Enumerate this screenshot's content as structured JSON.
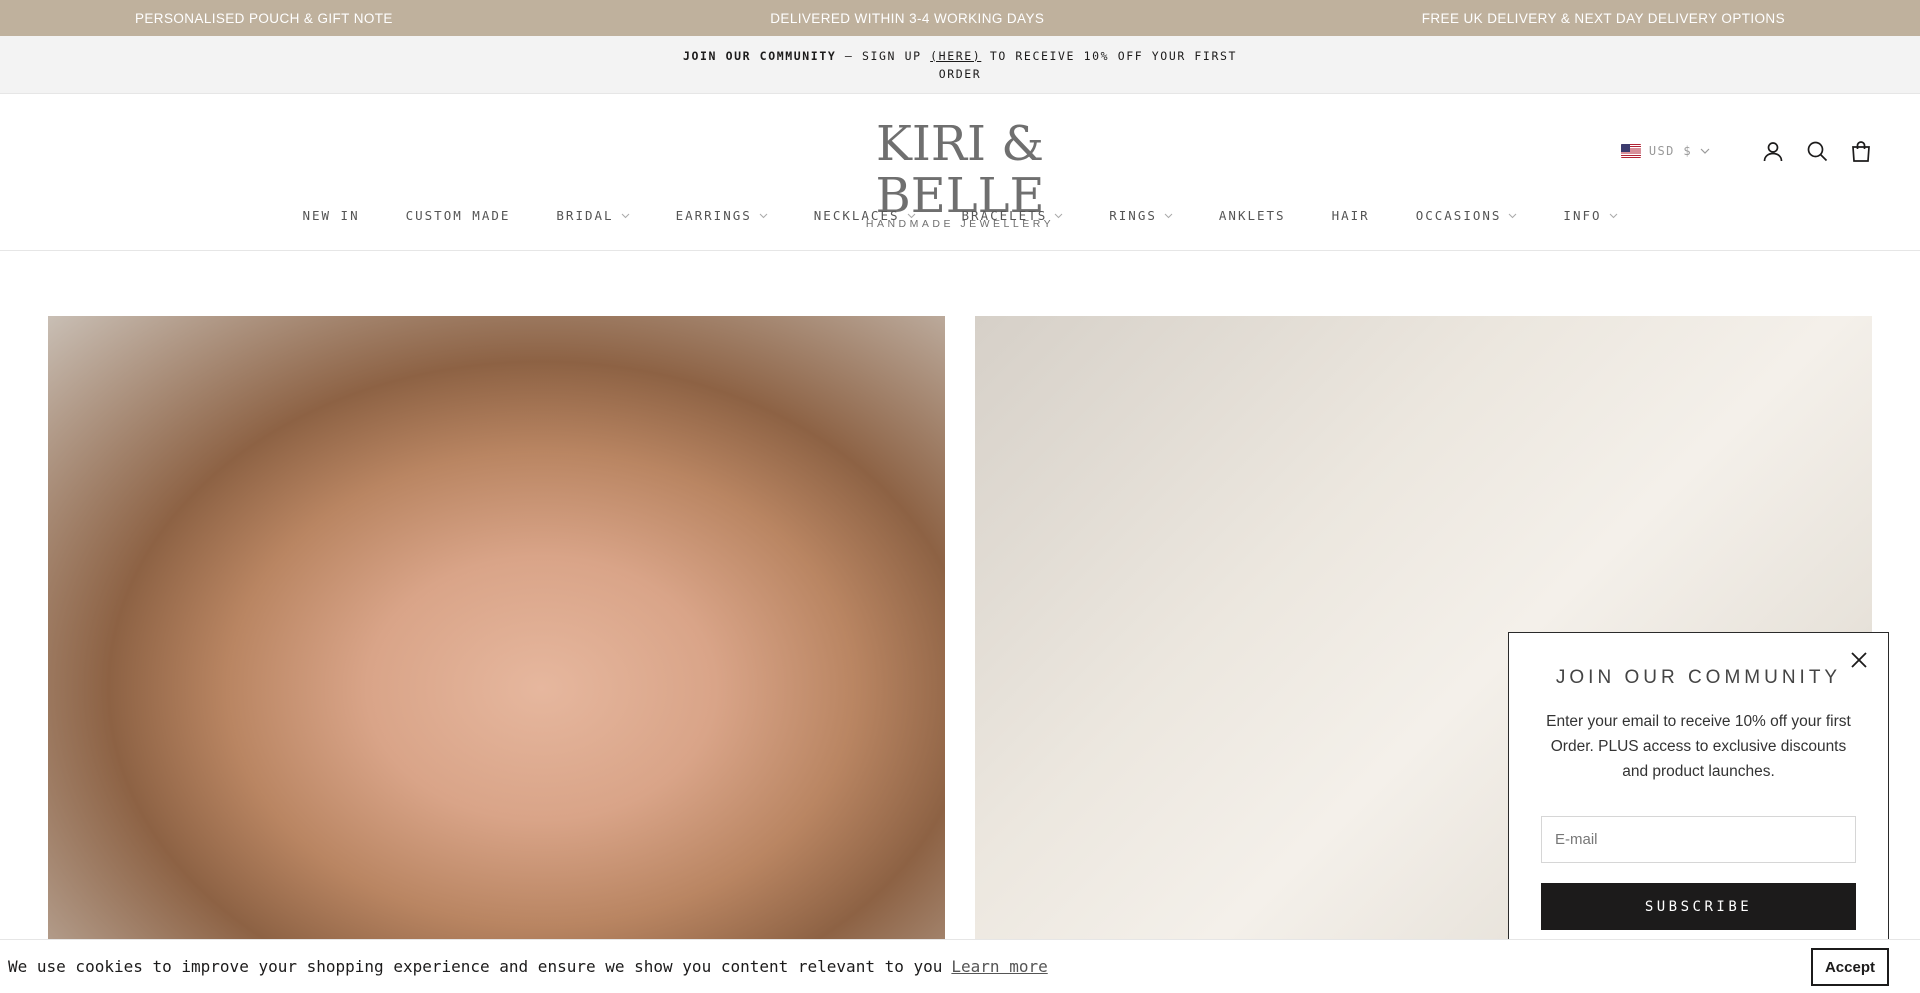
{
  "promo_bar": {
    "items": [
      "PERSONALISED POUCH & GIFT NOTE",
      "DELIVERED WITHIN 3-4 WORKING DAYS",
      "FREE UK DELIVERY & NEXT DAY DELIVERY OPTIONS"
    ],
    "background": "#bfb19d"
  },
  "community_bar": {
    "strong": "JOIN OUR COMMUNITY",
    "pre_link": " – SIGN UP ",
    "link": "(HERE)",
    "post_link": " TO RECEIVE 10% OFF YOUR FIRST ORDER"
  },
  "logo": {
    "main": "KIRI & BELLE",
    "sub": "HANDMADE JEWELLERY"
  },
  "header": {
    "currency_label": "USD $",
    "icons": [
      "us-flag-icon",
      "chevron-down-icon",
      "account-icon",
      "search-icon",
      "bag-icon"
    ]
  },
  "nav": {
    "items": [
      {
        "label": "NEW IN",
        "dropdown": false
      },
      {
        "label": "CUSTOM MADE",
        "dropdown": false
      },
      {
        "label": "BRIDAL",
        "dropdown": true
      },
      {
        "label": "EARRINGS",
        "dropdown": true
      },
      {
        "label": "NECKLACES",
        "dropdown": true
      },
      {
        "label": "BRACELETS",
        "dropdown": true
      },
      {
        "label": "RINGS",
        "dropdown": true
      },
      {
        "label": "ANKLETS",
        "dropdown": false
      },
      {
        "label": "HAIR",
        "dropdown": false
      },
      {
        "label": "OCCASIONS",
        "dropdown": true
      },
      {
        "label": "INFO",
        "dropdown": true
      }
    ]
  },
  "popup": {
    "title": "JOIN OUR COMMUNITY",
    "body": "Enter your email to receive 10% off your first Order. PLUS access to exclusive discounts and product launches.",
    "email_placeholder": "E-mail",
    "subscribe_label": "SUBSCRIBE"
  },
  "cookie": {
    "text": "We use cookies to improve your shopping experience and ensure we show you content relevant to you",
    "learn_more": "Learn more",
    "accept": "Accept"
  }
}
